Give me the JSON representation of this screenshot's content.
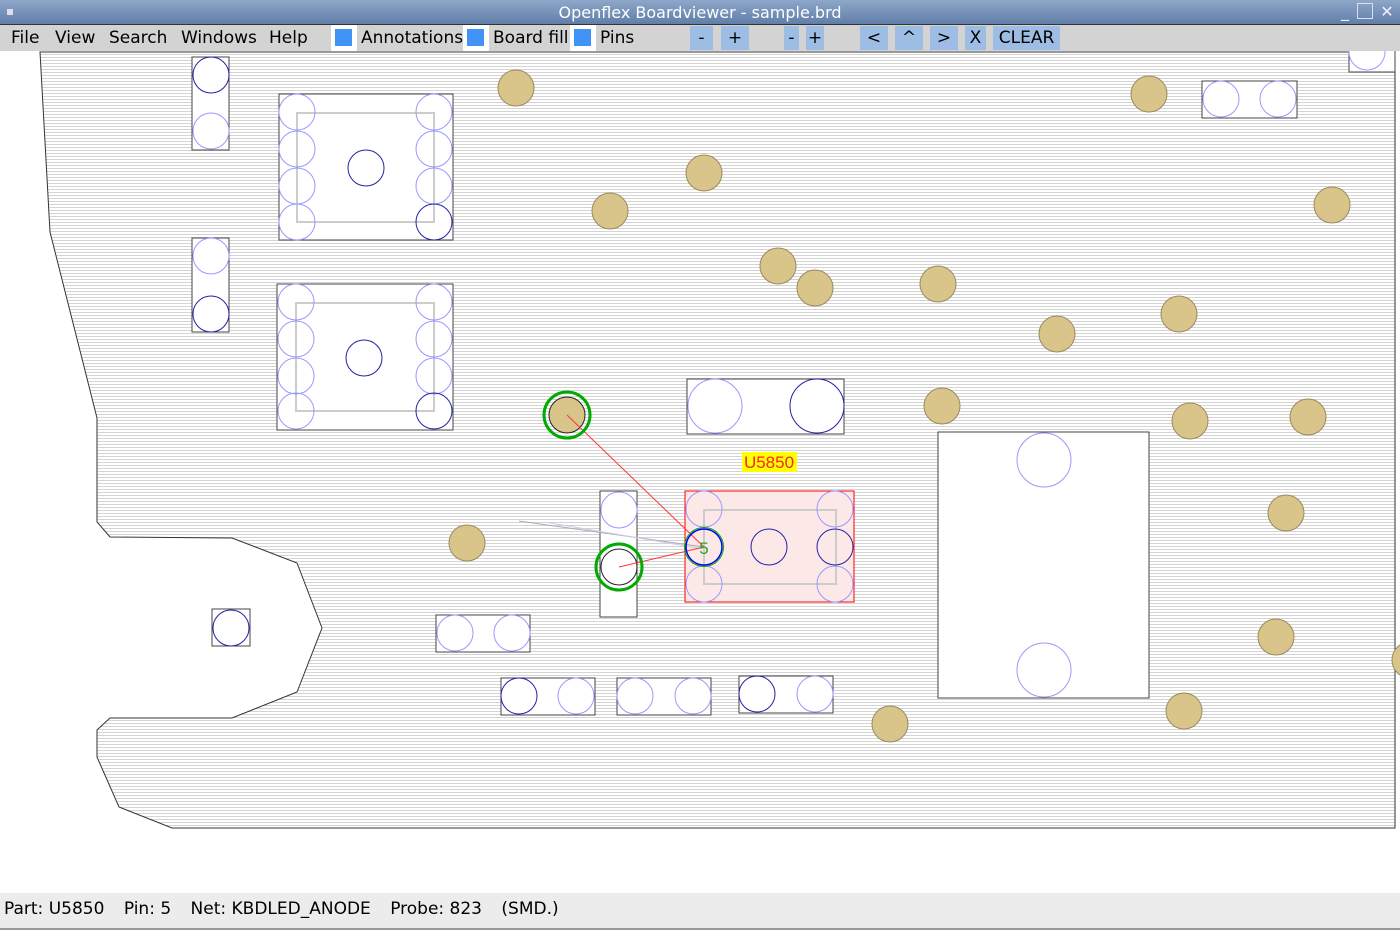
{
  "window": {
    "title": "Openflex Boardviewer - sample.brd"
  },
  "menu": [
    "File",
    "View",
    "Search",
    "Windows",
    "Help"
  ],
  "toggles": [
    {
      "label": "Annotations",
      "checked": true
    },
    {
      "label": "Board fill",
      "checked": true
    },
    {
      "label": "Pins",
      "checked": true
    }
  ],
  "toolbar": {
    "zoom_out": "-",
    "zoom_in": "+",
    "minus2": "-",
    "plus2": "+",
    "left": "<",
    "up": "^",
    "right": ">",
    "close": "X",
    "clear": "CLEAR"
  },
  "board": {
    "selected_part": "U5850",
    "selected_pin": "5"
  },
  "status": {
    "part": "Part: U5850",
    "pin": "Pin: 5",
    "net": "Net: KBDLED_ANODE",
    "probe": "Probe: 823",
    "type": "(SMD.)"
  },
  "colors": {
    "testpoint": "#d9c48a",
    "selection": "#ff0000",
    "highlight": "#00a000",
    "part_fill": "#fde8e8",
    "label_bg": "#ffff00"
  }
}
